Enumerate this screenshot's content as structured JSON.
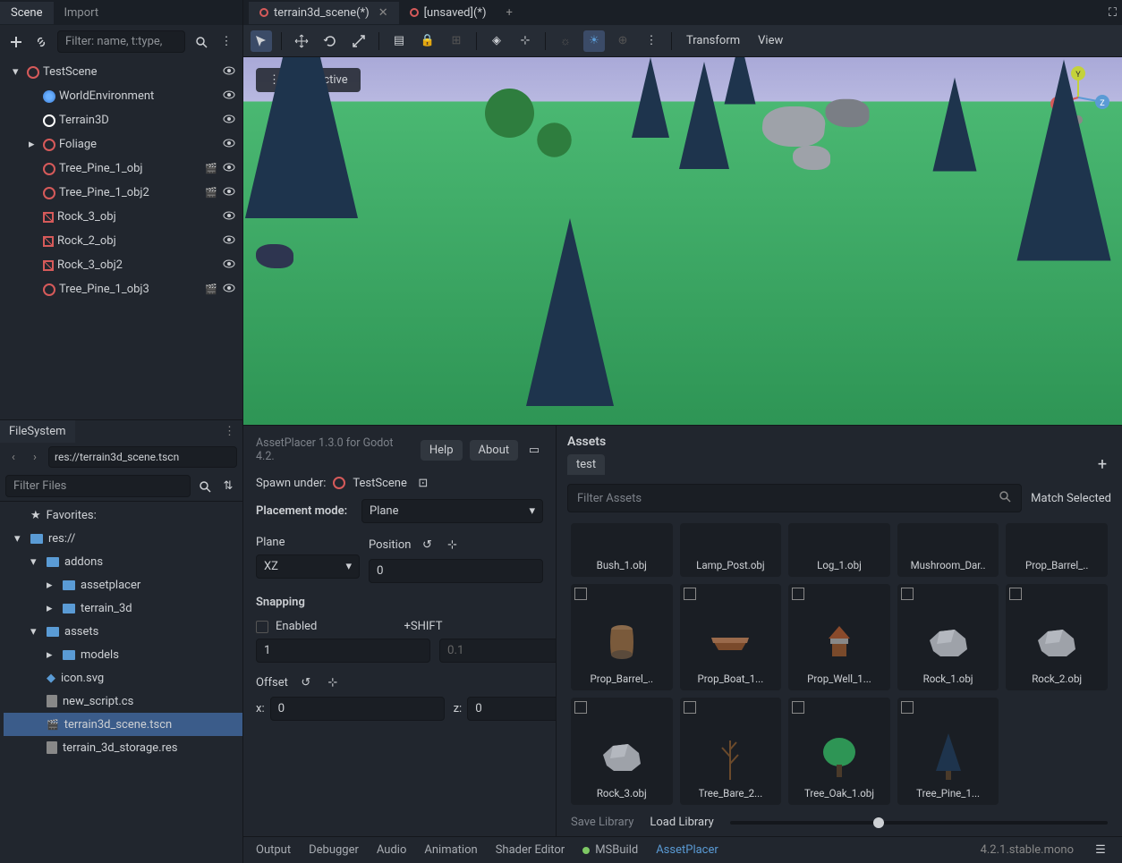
{
  "scene_panel": {
    "tabs": [
      "Scene",
      "Import"
    ],
    "filter_placeholder": "Filter: name, t:type,",
    "nodes": [
      {
        "name": "TestScene",
        "icon": "circle-red",
        "depth": 0,
        "eye": true,
        "arrow": "down"
      },
      {
        "name": "WorldEnvironment",
        "icon": "globe",
        "depth": 1,
        "eye": true
      },
      {
        "name": "Terrain3D",
        "icon": "circle",
        "depth": 1,
        "eye": true
      },
      {
        "name": "Foliage",
        "icon": "circle-red",
        "depth": 1,
        "eye": true,
        "arrow": "right"
      },
      {
        "name": "Tree_Pine_1_obj",
        "icon": "circle-red",
        "depth": 1,
        "eye": true,
        "clap": true
      },
      {
        "name": "Tree_Pine_1_obj2",
        "icon": "circle-red",
        "depth": 1,
        "eye": true,
        "clap": true
      },
      {
        "name": "Rock_3_obj",
        "icon": "slash",
        "depth": 1,
        "eye": true
      },
      {
        "name": "Rock_2_obj",
        "icon": "slash",
        "depth": 1,
        "eye": true
      },
      {
        "name": "Rock_3_obj2",
        "icon": "slash",
        "depth": 1,
        "eye": true
      },
      {
        "name": "Tree_Pine_1_obj3",
        "icon": "circle-red",
        "depth": 1,
        "eye": true,
        "clap": true
      }
    ]
  },
  "filesystem": {
    "tab": "FileSystem",
    "path": "res://terrain3d_scene.tscn",
    "filter_placeholder": "Filter Files",
    "tree": [
      {
        "name": "Favorites:",
        "icon": "star",
        "depth": 0
      },
      {
        "name": "res://",
        "icon": "folder",
        "depth": 0,
        "arrow": "down"
      },
      {
        "name": "addons",
        "icon": "folder",
        "depth": 1,
        "arrow": "down"
      },
      {
        "name": "assetplacer",
        "icon": "folder",
        "depth": 2,
        "arrow": "right"
      },
      {
        "name": "terrain_3d",
        "icon": "folder",
        "depth": 2,
        "arrow": "right"
      },
      {
        "name": "assets",
        "icon": "folder",
        "depth": 1,
        "arrow": "down"
      },
      {
        "name": "models",
        "icon": "folder",
        "depth": 2,
        "arrow": "right"
      },
      {
        "name": "icon.svg",
        "icon": "svg",
        "depth": 1
      },
      {
        "name": "new_script.cs",
        "icon": "file",
        "depth": 1
      },
      {
        "name": "terrain3d_scene.tscn",
        "icon": "scene",
        "depth": 1,
        "sel": true
      },
      {
        "name": "terrain_3d_storage.res",
        "icon": "file",
        "depth": 1
      }
    ]
  },
  "main_tabs": [
    {
      "label": "terrain3d_scene(*)",
      "active": true
    },
    {
      "label": "[unsaved](*)",
      "active": false
    }
  ],
  "toolbar_labels": {
    "transform": "Transform",
    "view": "View"
  },
  "perspective_label": "Perspective",
  "asset_placer": {
    "caption": "AssetPlacer 1.3.0 for Godot 4.2.",
    "help": "Help",
    "about": "About",
    "spawn_label": "Spawn under:",
    "spawn_value": "TestScene",
    "placement_mode_label": "Placement mode:",
    "placement_mode_value": "Plane",
    "plane_label": "Plane",
    "plane_value": "XZ",
    "position_label": "Position",
    "position_value": "0",
    "snapping_label": "Snapping",
    "enabled_label": "Enabled",
    "shift_label": "+SHIFT",
    "snap_val": "1",
    "shift_val": "0.1",
    "offset_label": "Offset",
    "x_label": "x:",
    "x_value": "0",
    "z_label": "z:",
    "z_value": "0"
  },
  "assets": {
    "title": "Assets",
    "tab": "test",
    "filter_placeholder": "Filter Assets",
    "match_selected": "Match Selected",
    "items": [
      {
        "label": "Bush_1.obj",
        "shape": "bush",
        "color": "#2e7d3e"
      },
      {
        "label": "Lamp_Post.obj",
        "shape": "lamp",
        "color": "#6b4a2b"
      },
      {
        "label": "Log_1.obj",
        "shape": "log",
        "color": "#6b4a2b"
      },
      {
        "label": "Mushroom_Dar..",
        "shape": "mushroom",
        "color": "#7a4a2b"
      },
      {
        "label": "Prop_Barrel_..",
        "shape": "barrel",
        "color": "#7a5a3b"
      },
      {
        "label": "Prop_Barrel_..",
        "shape": "barrel",
        "color": "#7a5a3b"
      },
      {
        "label": "Prop_Boat_1...",
        "shape": "boat",
        "color": "#7a4a2b"
      },
      {
        "label": "Prop_Well_1...",
        "shape": "well",
        "color": "#7a4a2b"
      },
      {
        "label": "Rock_1.obj",
        "shape": "rock",
        "color": "#9ea2a9"
      },
      {
        "label": "Rock_2.obj",
        "shape": "rock",
        "color": "#9ea2a9"
      },
      {
        "label": "Rock_3.obj",
        "shape": "rock",
        "color": "#9ea2a9"
      },
      {
        "label": "Tree_Bare_2...",
        "shape": "bare",
        "color": "#6b4a2b"
      },
      {
        "label": "Tree_Oak_1.obj",
        "shape": "oak",
        "color": "#2e9555"
      },
      {
        "label": "Tree_Pine_1...",
        "shape": "pine",
        "color": "#1e344d"
      }
    ],
    "save_library": "Save Library",
    "load_library": "Load Library"
  },
  "status": {
    "items": [
      "Output",
      "Debugger",
      "Audio",
      "Animation",
      "Shader Editor"
    ],
    "msbuild": "MSBuild",
    "asset_placer": "AssetPlacer",
    "version": "4.2.1.stable.mono"
  }
}
